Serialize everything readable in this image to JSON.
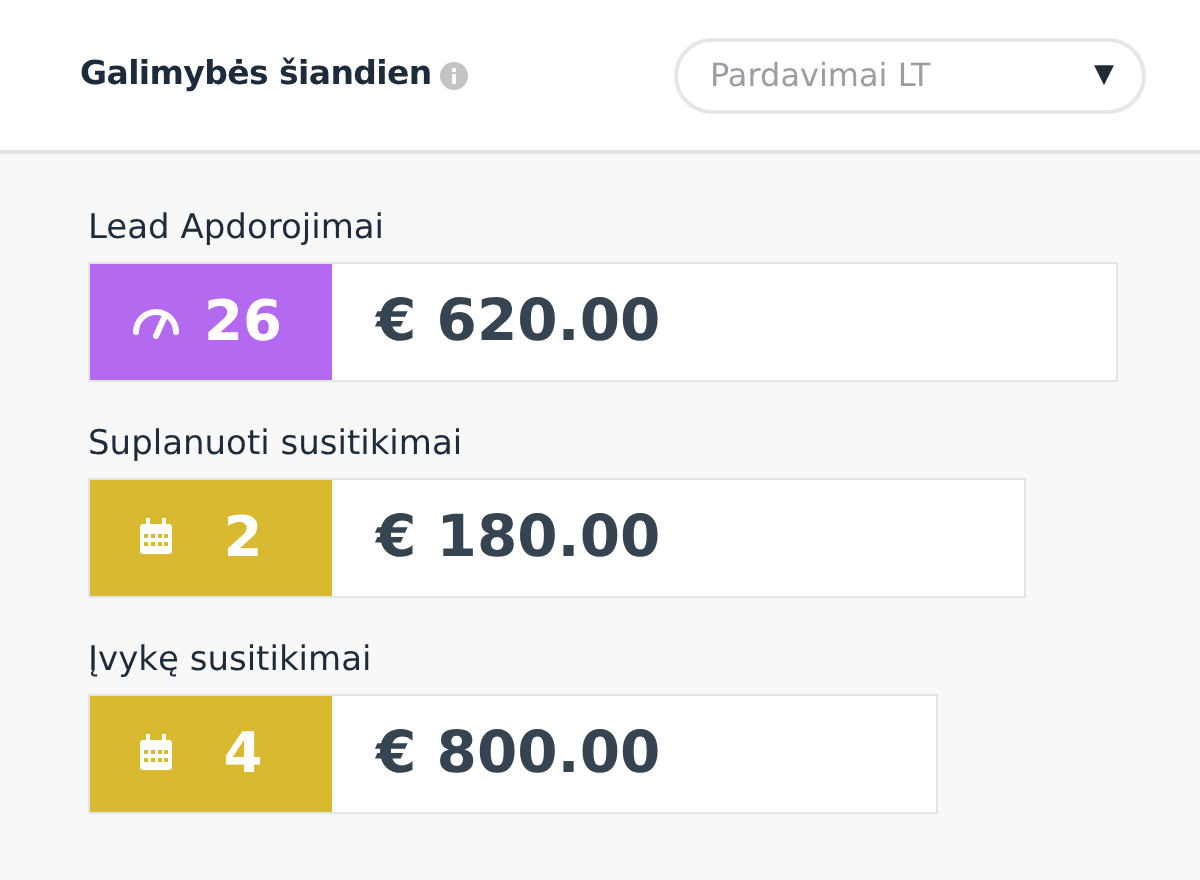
{
  "header": {
    "title": "Galimybės šiandien",
    "dropdown": {
      "value": "Pardavimai LT",
      "caret": "▼"
    }
  },
  "metrics": [
    {
      "label": "Lead Apdorojimai",
      "kind": "gauge",
      "color": "#b36af0",
      "count": "26",
      "amount": "€ 620.00"
    },
    {
      "label": "Suplanuoti susitikimai",
      "kind": "calendar",
      "color": "#d9b92f",
      "count": "2",
      "amount": "€ 180.00"
    },
    {
      "label": "Įvykę susitikimai",
      "kind": "calendar",
      "color": "#d9b92f",
      "count": "4",
      "amount": "€ 800.00"
    }
  ]
}
